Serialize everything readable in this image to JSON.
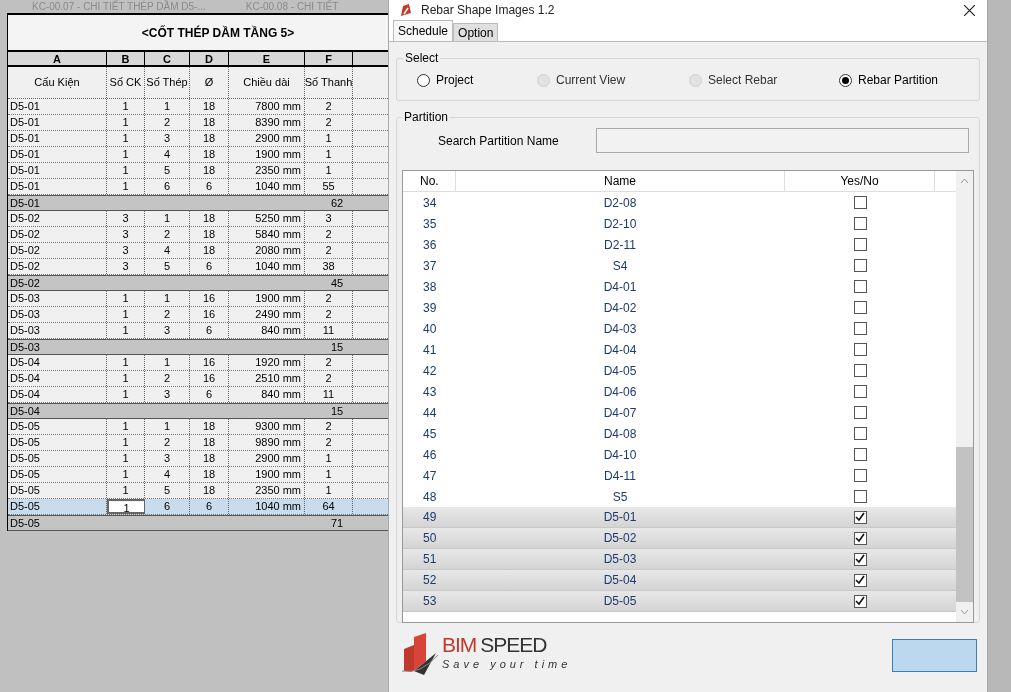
{
  "doc_tabs": [
    {
      "label": "KC-00.07 - CHI TIẾT THÉP DẦM D5-..."
    },
    {
      "label": "KC-00.08 - CHI TIẾT"
    }
  ],
  "schedule": {
    "title": "<CỐT THÉP DẦM TẦNG 5>",
    "column_letters": [
      "A",
      "B",
      "C",
      "D",
      "E",
      "F"
    ],
    "columns": [
      "Cấu Kiện",
      "Số CK",
      "Số Thép",
      "Ø",
      "Chiều dài",
      "Số Thanh"
    ],
    "rows": [
      {
        "kind": "data",
        "selected": false,
        "cells": [
          "D5-01",
          "1",
          "1",
          "18",
          "7800 mm",
          "2"
        ]
      },
      {
        "kind": "data",
        "selected": false,
        "cells": [
          "D5-01",
          "1",
          "2",
          "18",
          "8390 mm",
          "2"
        ]
      },
      {
        "kind": "data",
        "selected": false,
        "cells": [
          "D5-01",
          "1",
          "3",
          "18",
          "2900 mm",
          "1"
        ]
      },
      {
        "kind": "data",
        "selected": false,
        "cells": [
          "D5-01",
          "1",
          "4",
          "18",
          "1900 mm",
          "1"
        ]
      },
      {
        "kind": "data",
        "selected": false,
        "cells": [
          "D5-01",
          "1",
          "5",
          "18",
          "2350 mm",
          "1"
        ]
      },
      {
        "kind": "data",
        "selected": false,
        "cells": [
          "D5-01",
          "1",
          "6",
          "6",
          "1040 mm",
          "55"
        ]
      },
      {
        "kind": "total",
        "cells": [
          "D5-01",
          "62"
        ]
      },
      {
        "kind": "data",
        "selected": false,
        "cells": [
          "D5-02",
          "3",
          "1",
          "18",
          "5250 mm",
          "3"
        ]
      },
      {
        "kind": "data",
        "selected": false,
        "cells": [
          "D5-02",
          "3",
          "2",
          "18",
          "5840 mm",
          "2"
        ]
      },
      {
        "kind": "data",
        "selected": false,
        "cells": [
          "D5-02",
          "3",
          "4",
          "18",
          "2080 mm",
          "2"
        ]
      },
      {
        "kind": "data",
        "selected": false,
        "cells": [
          "D5-02",
          "3",
          "5",
          "6",
          "1040 mm",
          "38"
        ]
      },
      {
        "kind": "total",
        "cells": [
          "D5-02",
          "45"
        ]
      },
      {
        "kind": "data",
        "selected": false,
        "cells": [
          "D5-03",
          "1",
          "1",
          "16",
          "1900 mm",
          "2"
        ]
      },
      {
        "kind": "data",
        "selected": false,
        "cells": [
          "D5-03",
          "1",
          "2",
          "16",
          "2490 mm",
          "2"
        ]
      },
      {
        "kind": "data",
        "selected": false,
        "cells": [
          "D5-03",
          "1",
          "3",
          "6",
          "840 mm",
          "11"
        ]
      },
      {
        "kind": "total",
        "cells": [
          "D5-03",
          "15"
        ]
      },
      {
        "kind": "data",
        "selected": false,
        "cells": [
          "D5-04",
          "1",
          "1",
          "16",
          "1920 mm",
          "2"
        ]
      },
      {
        "kind": "data",
        "selected": false,
        "cells": [
          "D5-04",
          "1",
          "2",
          "16",
          "2510 mm",
          "2"
        ]
      },
      {
        "kind": "data",
        "selected": false,
        "cells": [
          "D5-04",
          "1",
          "3",
          "6",
          "840 mm",
          "11"
        ]
      },
      {
        "kind": "total",
        "cells": [
          "D5-04",
          "15"
        ]
      },
      {
        "kind": "data",
        "selected": false,
        "cells": [
          "D5-05",
          "1",
          "1",
          "18",
          "9300 mm",
          "2"
        ]
      },
      {
        "kind": "data",
        "selected": false,
        "cells": [
          "D5-05",
          "1",
          "2",
          "18",
          "9890 mm",
          "2"
        ]
      },
      {
        "kind": "data",
        "selected": false,
        "cells": [
          "D5-05",
          "1",
          "3",
          "18",
          "2900 mm",
          "1"
        ]
      },
      {
        "kind": "data",
        "selected": false,
        "cells": [
          "D5-05",
          "1",
          "4",
          "18",
          "1900 mm",
          "1"
        ]
      },
      {
        "kind": "data",
        "selected": false,
        "cells": [
          "D5-05",
          "1",
          "5",
          "18",
          "2350 mm",
          "1"
        ]
      },
      {
        "kind": "data",
        "selected": true,
        "cells": [
          "D5-05",
          "1",
          "6",
          "6",
          "1040 mm",
          "64"
        ]
      },
      {
        "kind": "total",
        "cells": [
          "D5-05",
          "71"
        ]
      }
    ]
  },
  "dialog": {
    "title": "Rebar Shape Images 1.2",
    "tabs": [
      {
        "label": "Schedule",
        "selected": true
      },
      {
        "label": "Option",
        "selected": false
      }
    ],
    "select": {
      "label": "Select",
      "options": [
        {
          "label": "Project",
          "selected": false,
          "disabled": false
        },
        {
          "label": "Current View",
          "selected": false,
          "disabled": true
        },
        {
          "label": "Select Rebar",
          "selected": false,
          "disabled": true
        },
        {
          "label": "Rebar Partition",
          "selected": true,
          "disabled": false
        }
      ]
    },
    "partition": {
      "label": "Partition",
      "search_label": "Search Partition Name",
      "columns": [
        "No.",
        "Name",
        "Yes/No"
      ],
      "rows": [
        {
          "no": "34",
          "name": "D2-08",
          "checked": false,
          "selected": false
        },
        {
          "no": "35",
          "name": "D2-10",
          "checked": false,
          "selected": false
        },
        {
          "no": "36",
          "name": "D2-11",
          "checked": false,
          "selected": false
        },
        {
          "no": "37",
          "name": "S4",
          "checked": false,
          "selected": false
        },
        {
          "no": "38",
          "name": "D4-01",
          "checked": false,
          "selected": false
        },
        {
          "no": "39",
          "name": "D4-02",
          "checked": false,
          "selected": false
        },
        {
          "no": "40",
          "name": "D4-03",
          "checked": false,
          "selected": false
        },
        {
          "no": "41",
          "name": "D4-04",
          "checked": false,
          "selected": false
        },
        {
          "no": "42",
          "name": "D4-05",
          "checked": false,
          "selected": false
        },
        {
          "no": "43",
          "name": "D4-06",
          "checked": false,
          "selected": false
        },
        {
          "no": "44",
          "name": "D4-07",
          "checked": false,
          "selected": false
        },
        {
          "no": "45",
          "name": "D4-08",
          "checked": false,
          "selected": false
        },
        {
          "no": "46",
          "name": "D4-10",
          "checked": false,
          "selected": false
        },
        {
          "no": "47",
          "name": "D4-11",
          "checked": false,
          "selected": false
        },
        {
          "no": "48",
          "name": "S5",
          "checked": false,
          "selected": false
        },
        {
          "no": "49",
          "name": "D5-01",
          "checked": true,
          "selected": true
        },
        {
          "no": "50",
          "name": "D5-02",
          "checked": true,
          "selected": true
        },
        {
          "no": "51",
          "name": "D5-03",
          "checked": true,
          "selected": true
        },
        {
          "no": "52",
          "name": "D5-04",
          "checked": true,
          "selected": true
        },
        {
          "no": "53",
          "name": "D5-05",
          "checked": true,
          "selected": true
        }
      ]
    },
    "logo": {
      "brand_a": "BIM",
      "brand_b": "SPEED",
      "tagline": "Save your time"
    }
  }
}
